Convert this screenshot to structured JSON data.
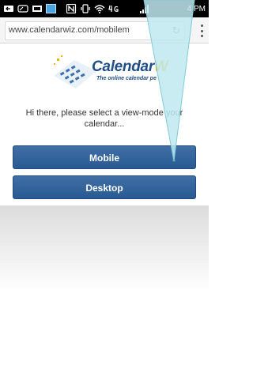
{
  "status_bar": {
    "time": "4 PM",
    "icons": [
      "back-arrow-icon",
      "voicemail-icon",
      "gallery-icon",
      "image-icon",
      "nfc-icon",
      "vibrate-icon",
      "wifi-icon",
      "4g-icon",
      "signal-icon"
    ]
  },
  "browser": {
    "url": "www.calendarwiz.com/mobilem",
    "reload_icon": "reload-icon",
    "menu_icon": "overflow-menu-icon"
  },
  "page": {
    "logo": {
      "name_main": "Calendar",
      "name_accent": "W",
      "tagline": "The online calendar pe"
    },
    "intro_text": "Hi there, please select a view-mode   your calendar...",
    "buttons": {
      "mobile": "Mobile",
      "desktop": "Desktop"
    }
  },
  "colors": {
    "button_bg": "#2f5f97",
    "logo_blue": "#1f4f86",
    "logo_accent": "#f0b400",
    "overlay_fill": "#bfe9f0"
  }
}
